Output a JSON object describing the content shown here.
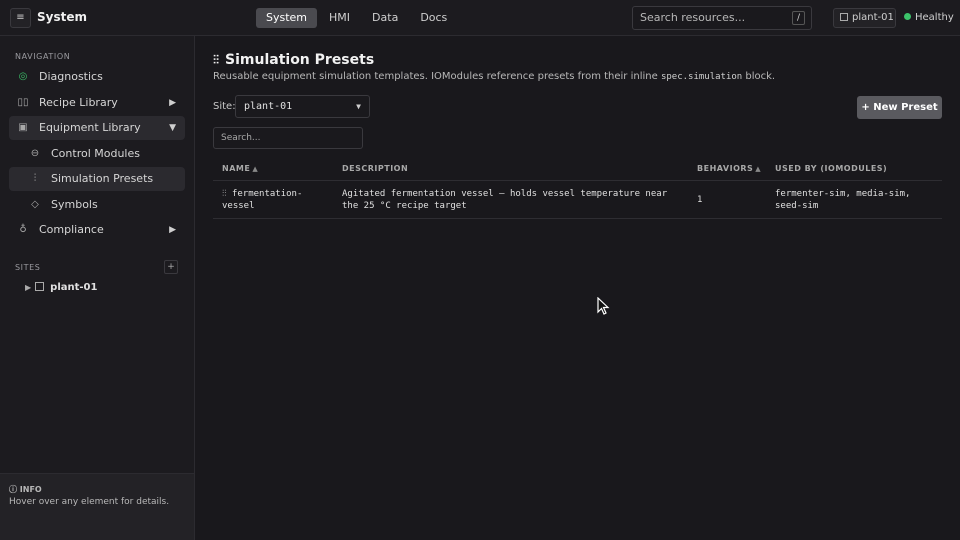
{
  "app": {
    "menu_icon": "≡",
    "title": "System"
  },
  "topbar": {
    "tabs": [
      {
        "label": "System",
        "active": true
      },
      {
        "label": "HMI",
        "active": false
      },
      {
        "label": "Data",
        "active": false
      },
      {
        "label": "Docs",
        "active": false
      }
    ],
    "search_placeholder": "Search resources...",
    "search_shortcut": "/",
    "site_chip": "plant-01",
    "health_status": "Healthy",
    "health_color": "#3cc36a"
  },
  "sidebar": {
    "navigation_label": "NAVIGATION",
    "items": [
      {
        "label": "Diagnostics",
        "icon": "diagnostics-icon"
      },
      {
        "label": "Recipe Library",
        "icon": "book-icon"
      },
      {
        "label": "Equipment Library",
        "icon": "equipment-icon"
      },
      {
        "label": "Control Modules",
        "icon": "control-module-icon"
      },
      {
        "label": "Simulation Presets",
        "icon": "sliders-icon"
      },
      {
        "label": "Symbols",
        "icon": "diamond-icon"
      },
      {
        "label": "Compliance",
        "icon": "ribbon-icon"
      }
    ],
    "sites_label": "SITES",
    "add_site": "+",
    "sites": [
      {
        "label": "plant-01"
      }
    ],
    "info": {
      "title": "INFO",
      "text": "Hover over any element for details."
    }
  },
  "main": {
    "title": "Simulation Presets",
    "description_before": "Reusable equipment simulation templates. IOModules reference presets from their inline ",
    "description_code": "spec.simulation",
    "description_after": " block.",
    "site_label": "Site:",
    "site_value": "plant-01",
    "new_button": "+ New Preset",
    "table_search_placeholder": "Search...",
    "columns": {
      "name": "NAME",
      "description": "DESCRIPTION",
      "behaviors": "BEHAVIORS",
      "used_by": "USED BY (IOMODULES)"
    },
    "rows": [
      {
        "name_line1": "fermentation-",
        "name_line2": "vessel",
        "description_line1": "Agitated fermentation vessel — holds vessel temperature near",
        "description_line2": "the 25 °C recipe target",
        "behaviors": "1",
        "used_by_line1": "fermenter-sim, media-sim,",
        "used_by_line2": "seed-sim"
      }
    ]
  }
}
